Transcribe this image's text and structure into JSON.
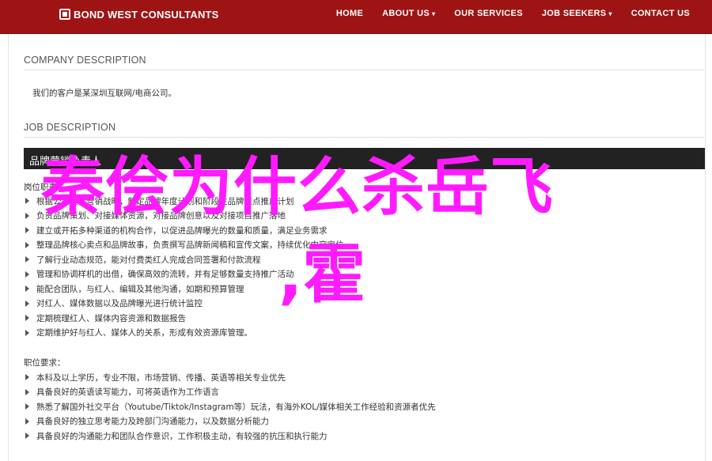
{
  "header": {
    "logo_text": "BOND WEST CONSULTANTS",
    "logo_icon": "square-logo-icon",
    "nav": [
      {
        "label": "HOME",
        "has_dropdown": false
      },
      {
        "label": "ABOUT US",
        "has_dropdown": true
      },
      {
        "label": "OUR SERVICES",
        "has_dropdown": false
      },
      {
        "label": "JOB SEEKERS",
        "has_dropdown": true
      },
      {
        "label": "CONTACT US",
        "has_dropdown": false
      }
    ],
    "dropdown_glyph": "▾"
  },
  "company": {
    "title": "COMPANY DESCRIPTION",
    "text": "我们的客户是某深圳互联网/电商公司。"
  },
  "job": {
    "title": "JOB DESCRIPTION",
    "position_title": "品牌营销负责人",
    "duties_label": "岗位职责：",
    "duties": [
      "根据公司整体营销战略，制定品牌年度计划和阶段性品牌重点推广计划",
      "负责品牌策划、对接媒体资源，对接品牌创意以及对接项目推广落地",
      "建立或开拓多种渠道的机构合作，以促进品牌曝光的数量和质量，满足业务需求",
      "整理品牌核心卖点和品牌故事，负责撰写品牌新闻稿和宣传文案，持续优化内容定位",
      "了解行业动态规范，能对付费类红人完成合同签署和付款流程",
      "管理和协调样机的出借，确保高效的流转，并有足够数量支持推广活动",
      "能配合团队，与红人、编辑及其他沟通，如期和预算管理",
      "对红人、媒体数据以及品牌曝光进行统计监控",
      "定期梳理红人、媒体内容资源和数据报告",
      "定期维护好与红人、媒体人的关系，形成有效资源库管理。"
    ],
    "requirements_label": "职位要求：",
    "requirements": [
      "本科及以上学历，专业不限，市场营销、传播、英语等相关专业优先",
      "具备良好的英语读写能力，可将英语作为工作语言",
      "熟悉了解国外社交平台（Youtube/Tiktok/Instagram等）玩法，有海外KOL/媒体相关工作经验和资源者优先",
      "具备良好的独立思考能力及跨部门沟通能力，以及数据分析能力",
      "具备良好的沟通能力和团队合作意识，工作积极主动，有较强的抗压和执行能力"
    ]
  },
  "overlay": {
    "line1": "秦侩为什么杀岳飞",
    "line2": ",霍",
    "color": "#ff1aff"
  },
  "colors": {
    "header_bg": "#9e1414",
    "position_bar_bg": "#222222"
  }
}
